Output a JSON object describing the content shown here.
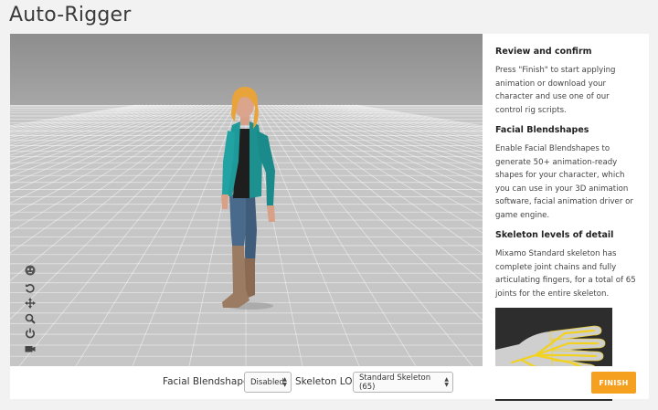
{
  "app": {
    "title": "Auto-Rigger"
  },
  "viewport": {
    "tools": [
      {
        "icon": "face-icon"
      },
      {
        "icon": "rotate-icon"
      },
      {
        "icon": "pan-icon"
      },
      {
        "icon": "zoom-icon"
      },
      {
        "icon": "power-icon"
      },
      {
        "icon": "camera-icon"
      }
    ]
  },
  "panel": {
    "sections": [
      {
        "heading": "Review and confirm",
        "body": "Press \"Finish\" to start applying animation or download your character and use one of our control rig scripts."
      },
      {
        "heading": "Facial Blendshapes",
        "body": "Enable Facial Blendshapes to generate 50+ animation-ready shapes for your character, which you can use in your 3D animation software, facial animation driver or game engine."
      },
      {
        "heading": "Skeleton levels of detail",
        "body": "Mixamo Standard skeleton has complete joint chains and fully articulating fingers, for a total of 65 joints for the entire skeleton."
      }
    ]
  },
  "controls": {
    "blendshapes_label": "Facial Blendshapes",
    "blendshapes_value": "Disabled",
    "lod_label": "Skeleton LOD",
    "lod_value": "Standard Skeleton (65)",
    "finish_label": "FINISH"
  },
  "colors": {
    "accent": "#f6a020",
    "skeleton": "#f2d21e",
    "jacket": "#1f9a9a",
    "hair": "#e8a33a"
  }
}
